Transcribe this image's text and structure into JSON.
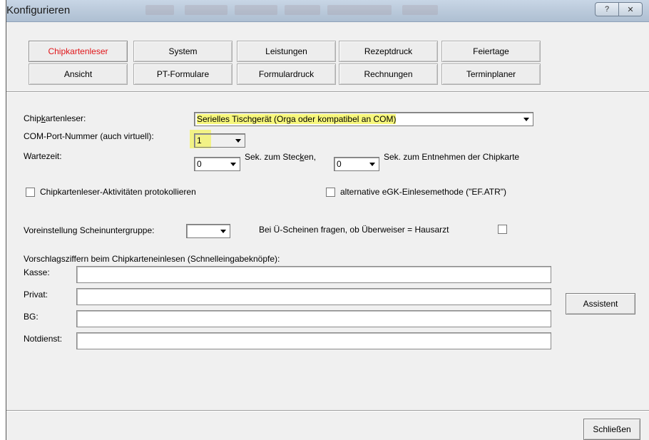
{
  "window": {
    "title": "Konfigurieren",
    "help_glyph": "?",
    "close_glyph": "✕"
  },
  "tabs": {
    "row1": [
      "Chipkartenleser",
      "System",
      "Leistungen",
      "Rezeptdruck",
      "Feiertage"
    ],
    "row2": [
      "Ansicht",
      "PT-Formulare",
      "Formulardruck",
      "Rechnungen",
      "Terminplaner"
    ],
    "active": "Chipkartenleser"
  },
  "form": {
    "reader_label_pre": "Chip",
    "reader_label_u": "k",
    "reader_label_post": "artenleser:",
    "reader_value": "Serielles Tischgerät (Orga oder kompatibel an COM)",
    "com_label": "COM-Port-Nummer (auch virtuell):",
    "com_value": "1",
    "wait_label": "Wartezeit:",
    "wait_insert_value": "0",
    "wait_insert_text_pre": "Sek. zum Stec",
    "wait_insert_text_u": "k",
    "wait_insert_text_post": "en,",
    "wait_remove_value": "0",
    "wait_remove_text": "Sek. zum Entnehmen der Chipkarte",
    "log_label": "Chipkartenleser-Aktivitäten protokollieren",
    "egk_label": "alternative eGK-Einlesemethode (\"EF.ATR\")",
    "subgroup_label": "Voreinstellung Scheinuntergruppe:",
    "subgroup_value": "",
    "referral_label": "Bei Ü-Scheinen fragen, ob Überweiser = Hausarzt",
    "suggest_heading": "Vorschlagsziffern beim Chipkarteneinlesen (Schnelleingabeknöpfe):",
    "kasse_label": "Kasse:",
    "privat_label": "Privat:",
    "bg_label": "BG:",
    "notdienst_label": "Notdienst:",
    "kasse_value": "",
    "privat_value": "",
    "bg_value": "",
    "notdienst_value": ""
  },
  "buttons": {
    "assistant": "Assistent",
    "close": "Schließen"
  },
  "colors": {
    "active_tab": "#e0161a",
    "highlight": "#f2f27a"
  }
}
